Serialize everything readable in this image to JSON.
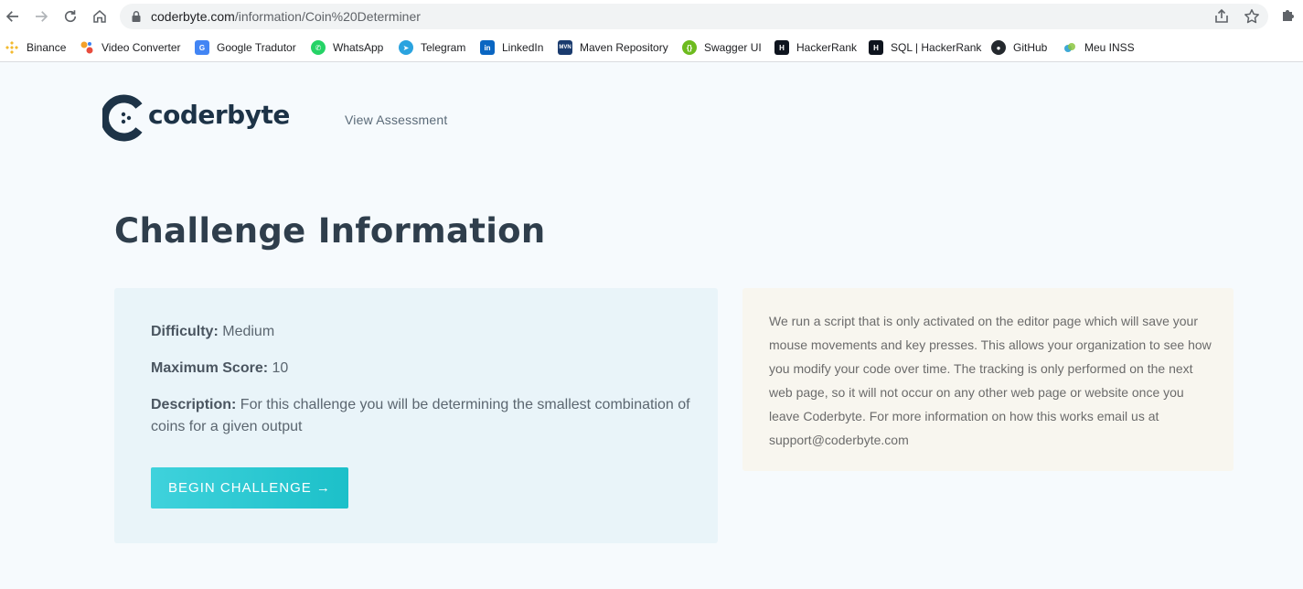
{
  "browser": {
    "url_host": "coderbyte.com",
    "url_path": "/information/Coin%20Determiner",
    "bookmarks": [
      {
        "label": "Binance",
        "icon": "binance-icon",
        "color": "#f3ba2f"
      },
      {
        "label": "Video Converter",
        "icon": "video-converter-icon",
        "color": "#f4a12a"
      },
      {
        "label": "Google Tradutor",
        "icon": "google-translate-icon",
        "color": "#4285f4"
      },
      {
        "label": "WhatsApp",
        "icon": "whatsapp-icon",
        "color": "#25d366"
      },
      {
        "label": "Telegram",
        "icon": "telegram-icon",
        "color": "#2aa3df"
      },
      {
        "label": "LinkedIn",
        "icon": "linkedin-icon",
        "color": "#0a66c2"
      },
      {
        "label": "Maven Repository",
        "icon": "maven-icon",
        "color": "#1a3b6e"
      },
      {
        "label": "Swagger UI",
        "icon": "swagger-icon",
        "color": "#6dbb1e"
      },
      {
        "label": "HackerRank",
        "icon": "hackerrank-icon",
        "color": "#0e141e"
      },
      {
        "label": "SQL | HackerRank",
        "icon": "hackerrank-icon",
        "color": "#0e141e"
      },
      {
        "label": "GitHub",
        "icon": "github-icon",
        "color": "#24292e"
      },
      {
        "label": "Meu INSS",
        "icon": "meu-inss-icon",
        "color": "#3fa9d6"
      }
    ]
  },
  "header": {
    "logo_text": "coderbyte",
    "nav_link": "View Assessment"
  },
  "page": {
    "title": "Challenge Information"
  },
  "challenge": {
    "difficulty_label": "Difficulty:",
    "difficulty_value": "Medium",
    "max_score_label": "Maximum Score:",
    "max_score_value": "10",
    "description_label": "Description:",
    "description_value": "For this challenge you will be determining the smallest combination of coins for a given output",
    "begin_button": "BEGIN CHALLENGE →"
  },
  "notice": {
    "text": "We run a script that is only activated on the editor page which will save your mouse movements and key presses. This allows your organization to see how you modify your code over time. The tracking is only performed on the next web page, so it will not occur on any other web page or website once you leave Coderbyte. For more information on how this works email us at support@coderbyte.com"
  },
  "colors": {
    "accent": "#1cc0c9",
    "brand_dark": "#1d3347",
    "info_card_bg": "#e9f4f9",
    "notice_bg": "#f8f6ef"
  }
}
